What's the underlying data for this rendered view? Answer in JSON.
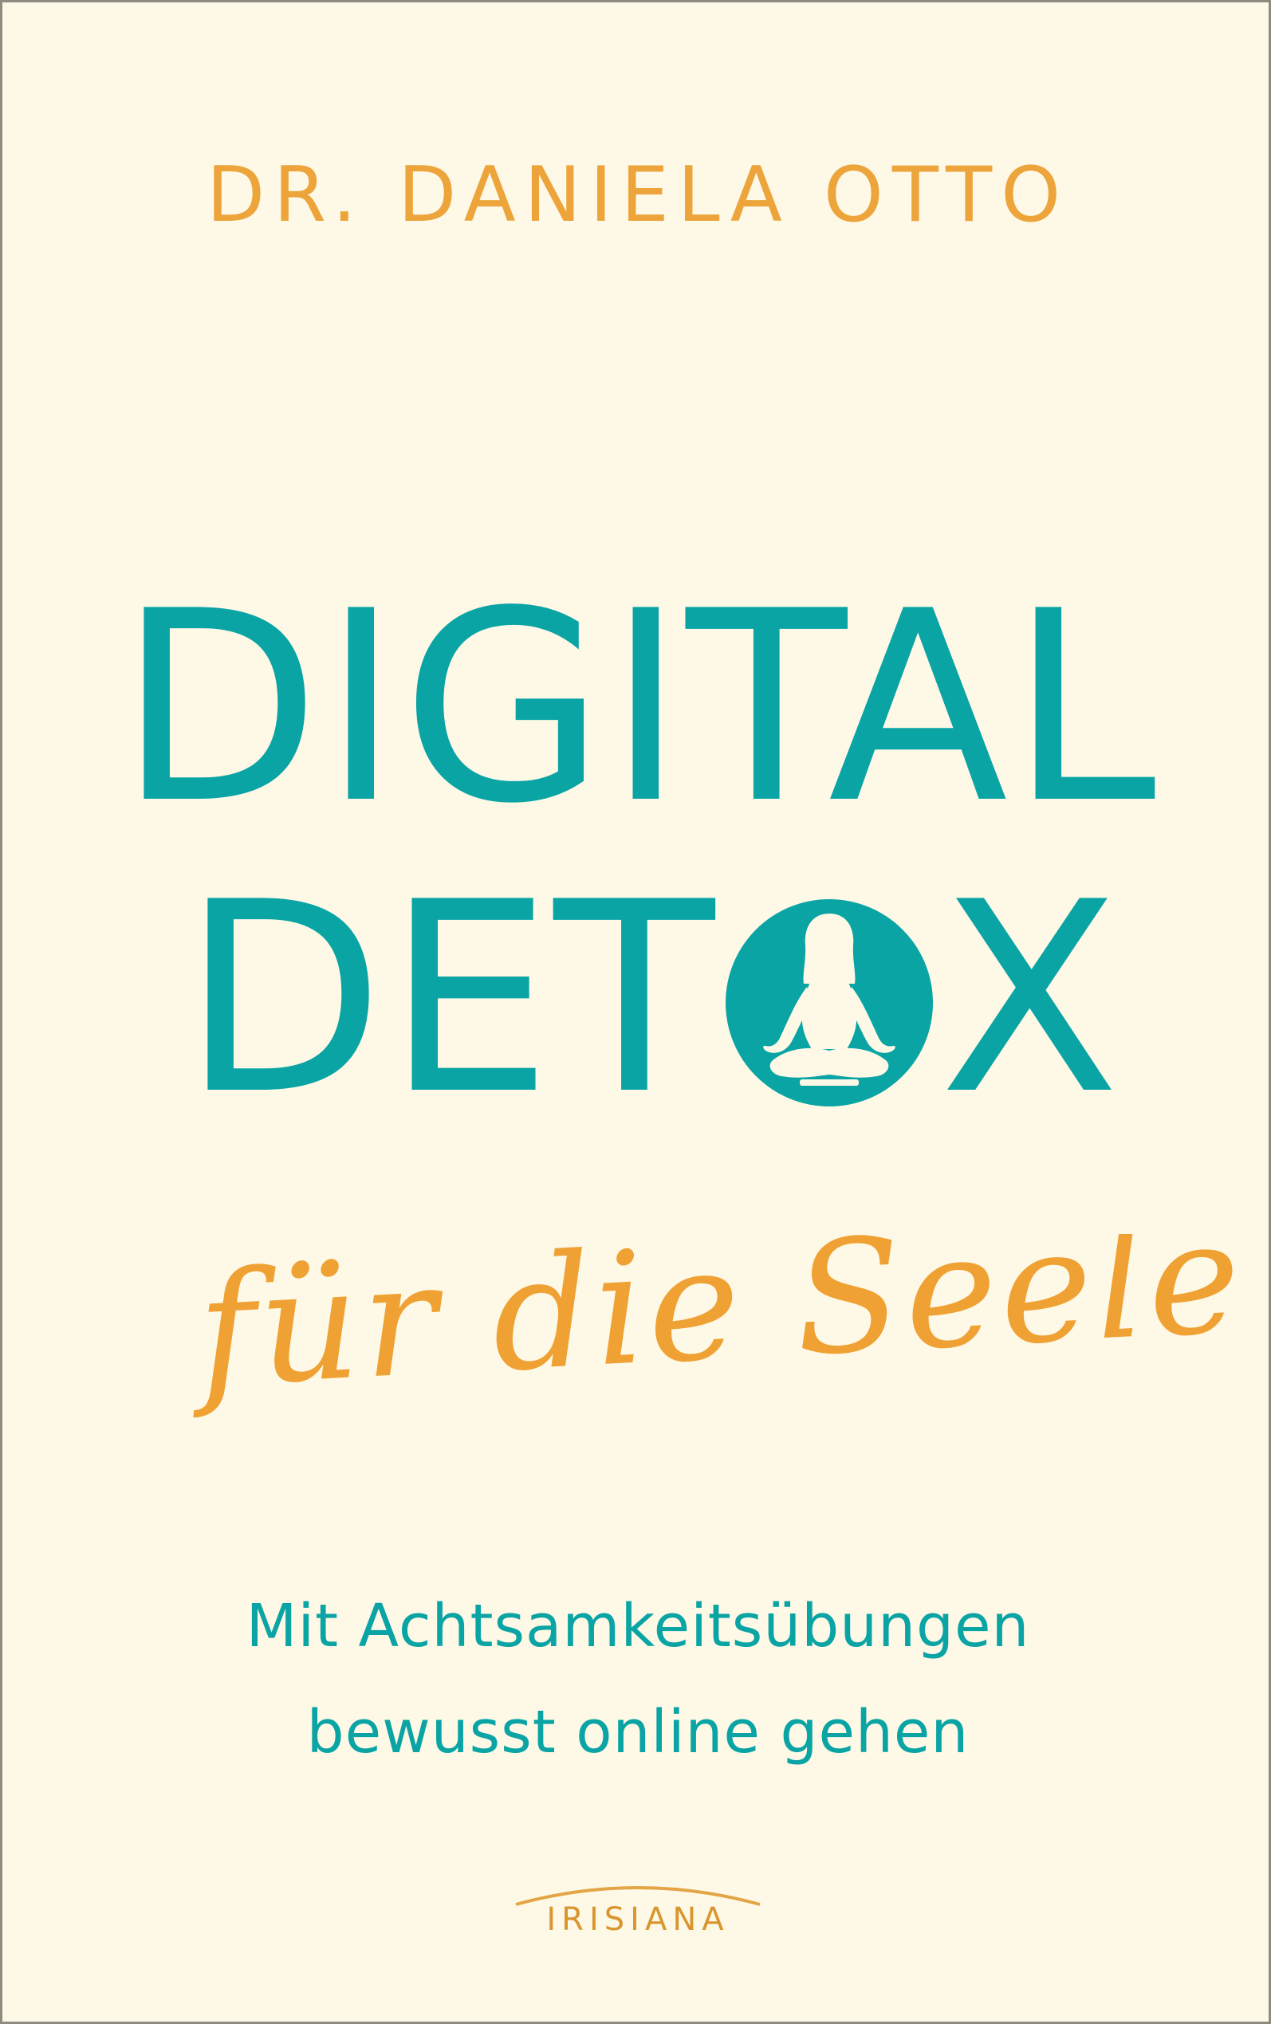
{
  "cover": {
    "author": "DR. DANIELA OTTO",
    "title_line_1": "DIGITAL",
    "title_line_2_prefix": "DET",
    "title_line_2_suffix": "X",
    "script_subtitle": "für die Seele",
    "subtitle_line_1": "Mit Achtsamkeitsübungen",
    "subtitle_line_2": "bewusst online gehen",
    "publisher": "IRISIANA"
  },
  "icons": {
    "title_o": "meditation-figure-icon",
    "publisher_arc": "arc-icon"
  },
  "colors": {
    "background": "#fdf9e6",
    "teal": "#0aa4a5",
    "orange": "#eca43b",
    "border": "#8e8b80"
  }
}
